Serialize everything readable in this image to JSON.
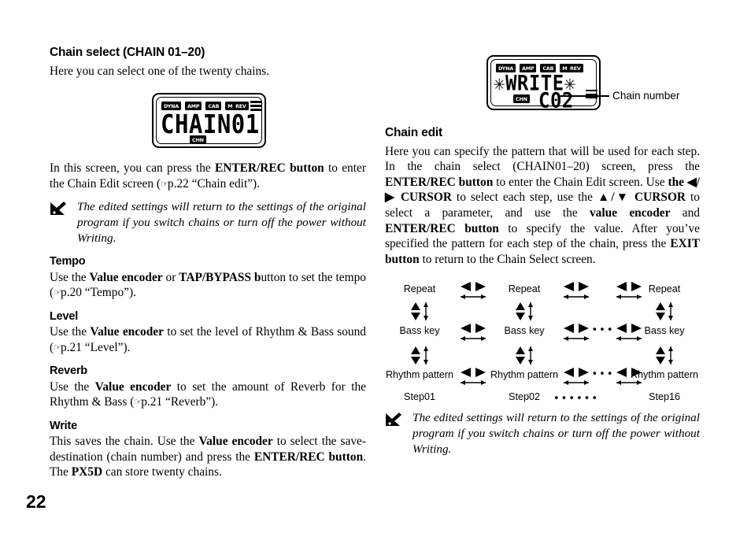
{
  "page": {
    "number": "22"
  },
  "left_column": {
    "heading": "Chain select (CHAIN 01–20)",
    "intro": "Here you can select one of the twenty chains.",
    "lcd": {
      "tags": [
        "DYNA",
        "AMP",
        "CAB",
        "MOD"
      ],
      "rev_tag": "REV",
      "line1": "CHAIN01",
      "chn_tag": "CHN"
    },
    "paragraph_parts": [
      {
        "text": "In this screen, you can press the ",
        "bold": false
      },
      {
        "text": "ENTER/REC button",
        "bold": true
      },
      {
        "text": " to enter the Chain Edit screen (",
        "bold": false
      },
      {
        "text": "☞",
        "bold": false,
        "hand": true
      },
      {
        "text": "p.22 “Chain edit”).",
        "bold": false
      }
    ],
    "note": "The edited settings will return to the settings of the original program if you switch chains or turn off the power without Writing.",
    "sections": [
      {
        "title": "Tempo",
        "parts": [
          {
            "text": "Use the ",
            "bold": false
          },
          {
            "text": "Value encoder",
            "bold": true
          },
          {
            "text": " or ",
            "bold": false
          },
          {
            "text": "TAP/BYPASS b",
            "bold": true
          },
          {
            "text": "utton to set the tempo (",
            "bold": false
          },
          {
            "text": "☞",
            "bold": false,
            "hand": true
          },
          {
            "text": "p.20 “Tempo”).",
            "bold": false
          }
        ]
      },
      {
        "title": "Level",
        "parts": [
          {
            "text": "Use the ",
            "bold": false
          },
          {
            "text": "Value encoder",
            "bold": true
          },
          {
            "text": " to set the level of Rhythm & Bass sound (",
            "bold": false
          },
          {
            "text": "☞",
            "bold": false,
            "hand": true
          },
          {
            "text": "p.21 “Level”).",
            "bold": false
          }
        ]
      },
      {
        "title": "Reverb",
        "parts": [
          {
            "text": "Use the ",
            "bold": false
          },
          {
            "text": "Value encoder",
            "bold": true
          },
          {
            "text": " to set the amount of Reverb for the Rhythm & Bass (",
            "bold": false
          },
          {
            "text": "☞",
            "bold": false,
            "hand": true
          },
          {
            "text": "p.21 “Reverb”).",
            "bold": false
          }
        ]
      },
      {
        "title": "Write",
        "parts": [
          {
            "text": "This saves the chain. Use the ",
            "bold": false
          },
          {
            "text": "Value encoder",
            "bold": true
          },
          {
            "text": " to select the save-destination (chain number) and press the ",
            "bold": false
          },
          {
            "text": "ENTER/REC button",
            "bold": true
          },
          {
            "text": ". The ",
            "bold": false
          },
          {
            "text": "PX5D",
            "bold": true
          },
          {
            "text": " can store twenty chains.",
            "bold": false
          }
        ]
      }
    ]
  },
  "right_column": {
    "lcd": {
      "tags": [
        "DYNA",
        "AMP",
        "CAB",
        "MOD"
      ],
      "rev_tag": "REV",
      "line1": "✳WRITE✳",
      "line2": "C02",
      "chn_tag": "CHN"
    },
    "callout": "Chain number",
    "heading": "Chain edit",
    "paragraph_parts": [
      {
        "text": "Here you can specify the pattern that will be used for each step. In the chain select (CHAIN01–20) screen, press the ",
        "bold": false
      },
      {
        "text": "ENTER/REC button",
        "bold": true
      },
      {
        "text": " to enter the Chain Edit screen. Use ",
        "bold": false
      },
      {
        "text": "the ◀/▶ CURSOR",
        "bold": true
      },
      {
        "text": " to select each step, use the ",
        "bold": false
      },
      {
        "text": "▲/▼ CURSOR",
        "bold": true
      },
      {
        "text": " to select a parameter, and use the ",
        "bold": false
      },
      {
        "text": "value encoder",
        "bold": true
      },
      {
        "text": " and ",
        "bold": false
      },
      {
        "text": "ENTER/REC button",
        "bold": true
      },
      {
        "text": " to specify the value. After you’ve specified the pattern for each step of the chain, press the ",
        "bold": false
      },
      {
        "text": "EXIT button",
        "bold": true
      },
      {
        "text": " to return to the Chain Select screen.",
        "bold": false
      }
    ],
    "note": "The edited settings will return to the settings of the original program if you switch chains or turn off the power without Writing."
  },
  "step_diagram": {
    "row_labels": [
      "Repeat",
      "Bass key",
      "Rhythm pattern"
    ],
    "step_labels": [
      "Step01",
      "Step02",
      "Step16"
    ],
    "ellipsis_mid": "•••",
    "ellipsis_bottom": "••••••"
  }
}
